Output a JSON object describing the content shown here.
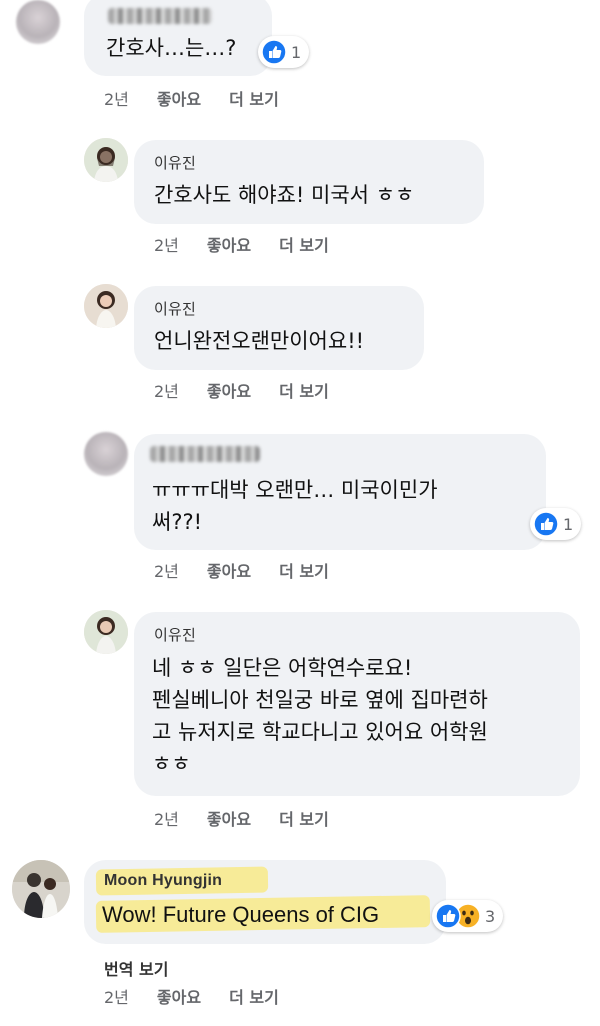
{
  "colors": {
    "bubble": "#f0f2f5",
    "like_blue": "#1877f2",
    "meta_gray": "#65676b",
    "highlight": "#f5e36c"
  },
  "comments": [
    {
      "author": "",
      "author_blurred": true,
      "text": "간호사…는…?",
      "reaction_count": "1",
      "time": "2년",
      "like": "좋아요",
      "more": "더 보기"
    },
    {
      "author": "이유진",
      "text": "간호사도 해야죠! 미국서 ㅎㅎ",
      "time": "2년",
      "like": "좋아요",
      "more": "더 보기"
    },
    {
      "author": "이유진",
      "text": "언니완전오랜만이어요!!",
      "time": "2년",
      "like": "좋아요",
      "more": "더 보기"
    },
    {
      "author": "",
      "author_blurred": true,
      "text": "ㅠㅠㅠ대박 오랜만… 미국이민가\n써??!",
      "reaction_count": "1",
      "time": "2년",
      "like": "좋아요",
      "more": "더 보기"
    },
    {
      "author": "이유진",
      "text": "네 ㅎㅎ 일단은 어학연수로요!\n펜실베니아 천일궁 바로 옆에 집마련하\n고 뉴저지로 학교다니고 있어요 어학원\nㅎㅎ",
      "time": "2년",
      "like": "좋아요",
      "more": "더 보기"
    },
    {
      "author": "Moon Hyungjin",
      "text": "Wow! Future Queens of CIG",
      "reaction_count": "3",
      "translate": "번역 보기",
      "time": "2년",
      "like": "좋아요",
      "more": "더 보기"
    }
  ],
  "icons": {
    "like": "thumbs-up-icon",
    "wow": "wow-face-icon"
  }
}
